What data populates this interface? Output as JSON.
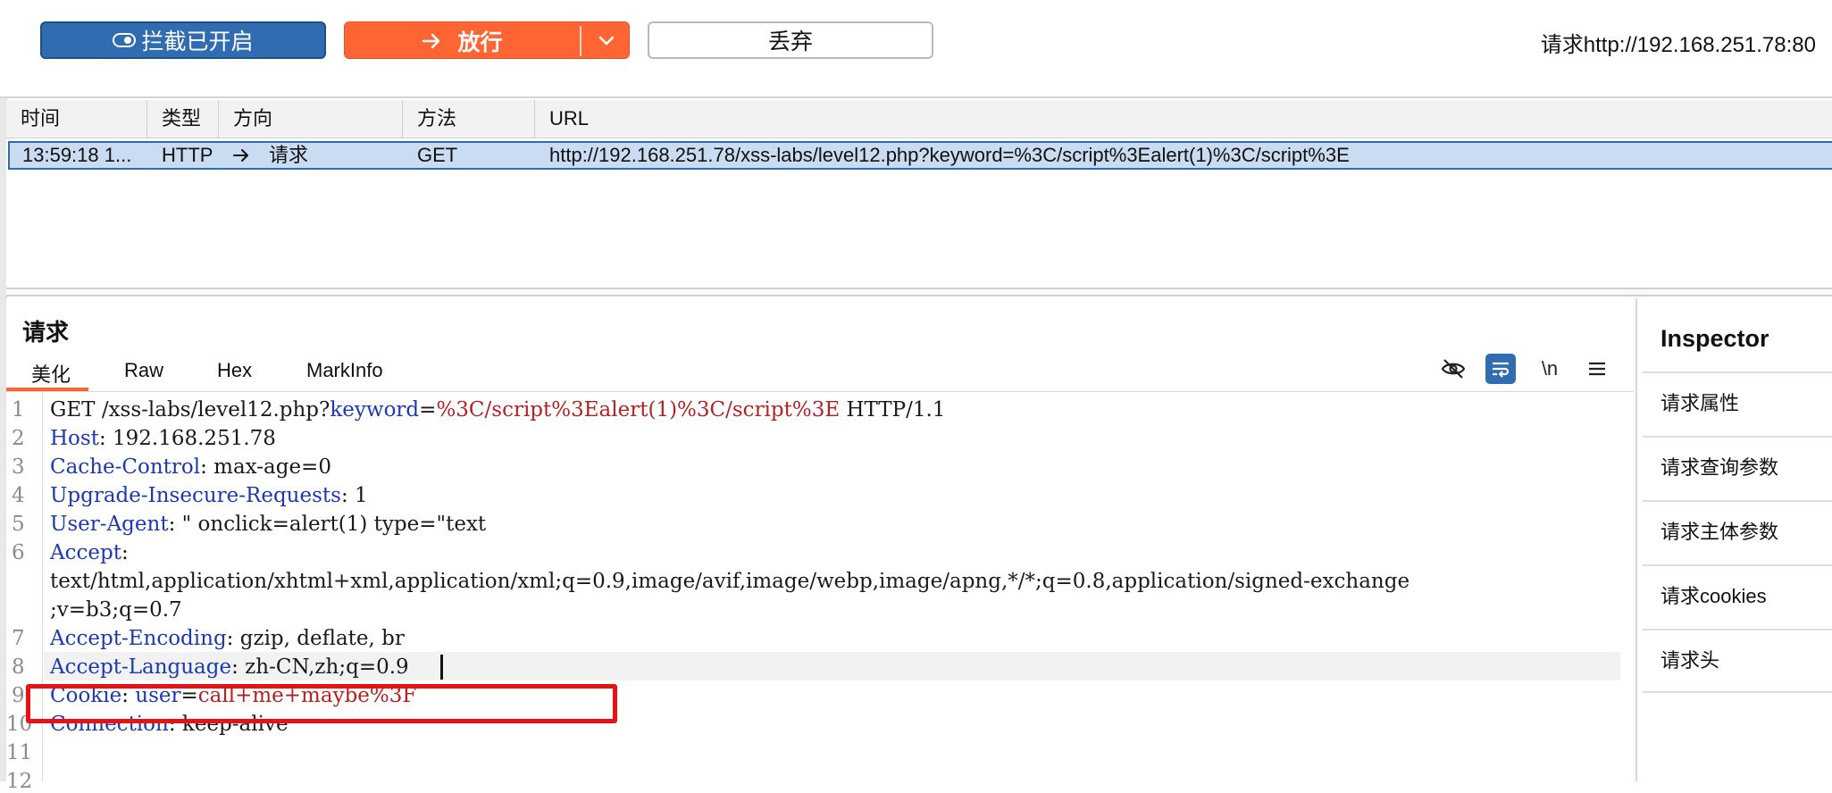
{
  "toolbar": {
    "intercept_label": "拦截已开启",
    "forward_label": "放行",
    "drop_label": "丢弃",
    "request_host": "请求http://192.168.251.78:80"
  },
  "table": {
    "headers": [
      "时间",
      "类型",
      "方向",
      "方法",
      "URL"
    ],
    "rows": [
      {
        "time": "13:59:18 1...",
        "type": "HTTP",
        "direction": "请求",
        "method": "GET",
        "url": "http://192.168.251.78/xss-labs/level12.php?keyword=%3C/script%3Ealert(1)%3C/script%3E"
      }
    ]
  },
  "request": {
    "title": "请求",
    "tabs": [
      "美化",
      "Raw",
      "Hex",
      "MarkInfo"
    ],
    "active_tab": "美化",
    "icons": [
      "hide-icon",
      "wrap-icon",
      "newline-icon",
      "menu-icon"
    ],
    "newline_label": "\\n",
    "lines": {
      "l1_method": "GET /xss-labs/level12.php?",
      "l1_param": "keyword",
      "l1_eq": "=",
      "l1_value": "%3C/script%3Ealert(1)%3C/script%3E",
      "l1_proto": " HTTP/1.1",
      "l2_key": "Host",
      "l2_val": ": 192.168.251.78",
      "l3_key": "Cache-Control",
      "l3_val": ": max-age=0",
      "l4_key": "Upgrade-Insecure-Requests",
      "l4_val": ": 1",
      "l5_key": "User-Agent",
      "l5_val": ": \" onclick=alert(1) type=\"text",
      "l6_key": "Accept",
      "l6_val": ":",
      "l6_cont1": "text/html,application/xhtml+xml,application/xml;q=0.9,image/avif,image/webp,image/apng,*/*;q=0.8,application/signed-exchange",
      "l6_cont2": ";v=b3;q=0.7",
      "l7_key": "Accept-Encoding",
      "l7_val": ": gzip, deflate, br",
      "l8_key": "Accept-Language",
      "l8_val": ": zh-CN,zh;q=0.9",
      "l9_key": "Cookie",
      "l9_sep": ": ",
      "l9_param": "user",
      "l9_eq": "=",
      "l9_value": "call+me+maybe%3F",
      "l10_key": "Connection",
      "l10_val": ": keep-alive"
    },
    "line_numbers": [
      "1",
      "2",
      "3",
      "4",
      "5",
      "6",
      "7",
      "8",
      "9",
      "10",
      "11",
      "12"
    ]
  },
  "inspector": {
    "title": "Inspector",
    "items": [
      "请求属性",
      "请求查询参数",
      "请求主体参数",
      "请求cookies",
      "请求头"
    ]
  },
  "colors": {
    "intercept_button": "#2f6cb0",
    "forward_button": "#ff6533",
    "selected_row": "#c9dcf2",
    "highlight_box": "#e81212",
    "header_key": "#1b39b0",
    "param_value": "#b22222"
  }
}
